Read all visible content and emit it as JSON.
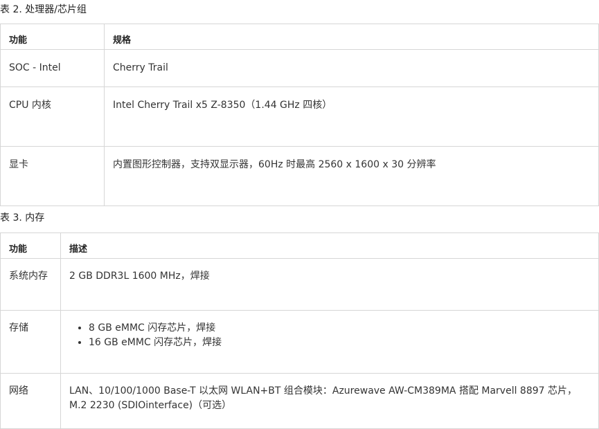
{
  "table2": {
    "caption": "表 2. 处理器/芯片组",
    "headers": [
      "功能",
      "规格"
    ],
    "rows": [
      {
        "feature": "SOC - Intel",
        "spec": "Cherry Trail"
      },
      {
        "feature": "CPU 内核",
        "spec": "Intel Cherry Trail x5 Z-8350（1.44 GHz 四核）"
      },
      {
        "feature": "显卡",
        "spec": "内置图形控制器，支持双显示器，60Hz 时最高 2560 x 1600 x 30 分辨率"
      }
    ]
  },
  "table3": {
    "caption": "表 3. 内存",
    "headers": [
      "功能",
      "描述"
    ],
    "rows": [
      {
        "feature": "系统内存",
        "desc": "2 GB DDR3L 1600 MHz，焊接"
      },
      {
        "feature": "存储",
        "items": [
          "8 GB eMMC 闪存芯片，焊接",
          "16 GB eMMC 闪存芯片，焊接"
        ]
      },
      {
        "feature": "网络",
        "desc": "LAN、10/100/1000 Base-T 以太网 WLAN+BT 组合模块：Azurewave AW-CM389MA 搭配 Marvell 8897 芯片，M.2 2230 (SDIOinterface)（可选）"
      }
    ]
  }
}
